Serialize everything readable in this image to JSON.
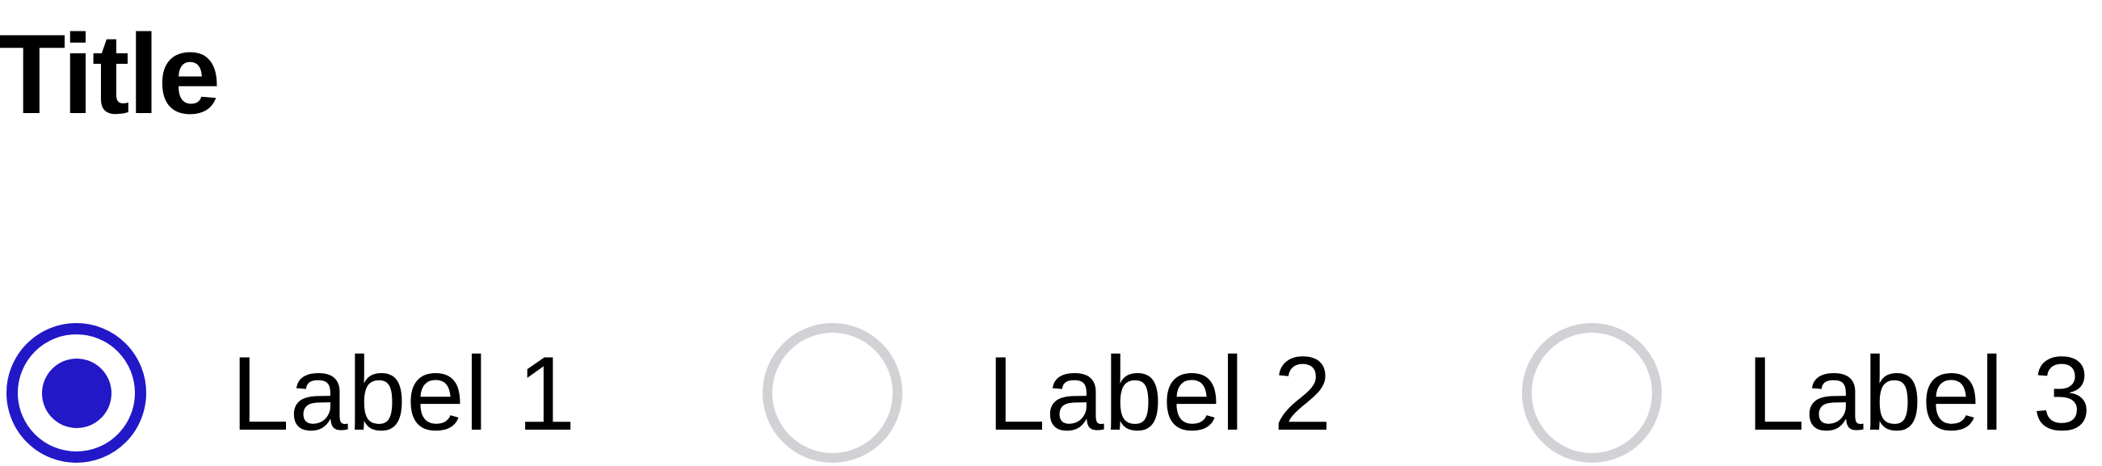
{
  "title": "Title",
  "colors": {
    "accent": "#2218c7",
    "unselected_border": "#d2d2d6",
    "text": "#000000",
    "background": "#ffffff"
  },
  "radio_group": {
    "selected_index": 0,
    "options": [
      {
        "label": "Label 1",
        "selected": true
      },
      {
        "label": "Label 2",
        "selected": false
      },
      {
        "label": "Label 3",
        "selected": false
      }
    ]
  }
}
